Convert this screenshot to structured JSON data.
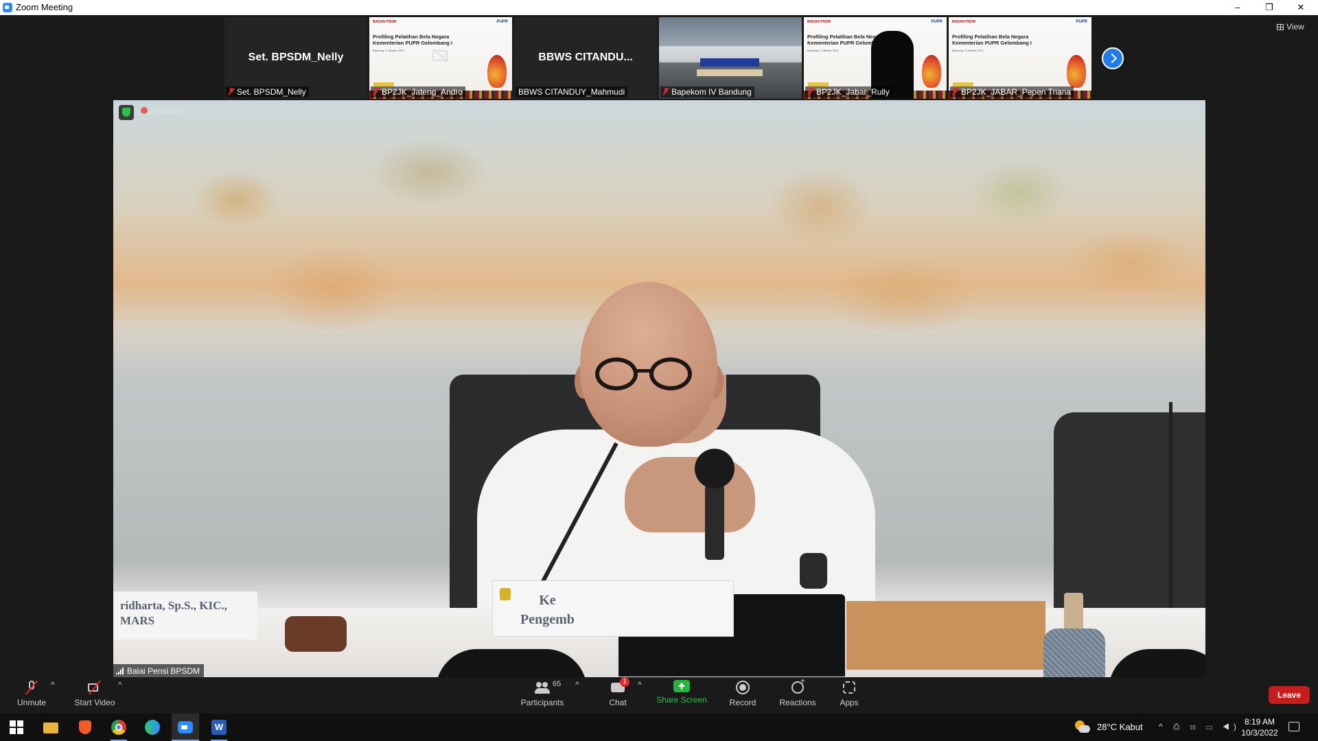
{
  "window": {
    "title": "Zoom Meeting",
    "min": "–",
    "max": "❐",
    "close": "✕"
  },
  "view_button": "View",
  "gallery": [
    {
      "big_name": "Set. BPSDM_Nelly",
      "label": "Set. BPSDM_Nelly",
      "muted": true,
      "kind": "name"
    },
    {
      "big_name": "",
      "label": "BP2JK_Jateng_Andro",
      "muted": true,
      "kind": "slide-camoff"
    },
    {
      "big_name": "BBWS  CITANDU...",
      "label": "BBWS CITANDUY_Mahmudi",
      "muted": false,
      "kind": "name"
    },
    {
      "big_name": "",
      "label": "Bapekom IV Bandung",
      "muted": true,
      "kind": "photo"
    },
    {
      "big_name": "",
      "label": "BP2JK_Jabar_Rully",
      "muted": true,
      "kind": "slide-person"
    },
    {
      "big_name": "",
      "label": "BP2JK_JABAR_Pepen Triana",
      "muted": true,
      "kind": "slide"
    }
  ],
  "slide": {
    "title": "Profiling Pelatihan Bela Negara Kementerian PUPR Gelombang I",
    "date": "Bandung, 3 Oktober 2022",
    "logo": "BADAN PSDM",
    "pupr": "PUPR"
  },
  "main_video": {
    "speaker_label": "Balai Pensi BPSDM",
    "recording": "Recording",
    "placard_left": "ridharta, Sp.S., KIC.,\nMARS",
    "placard_center": "Ke\nPengemb"
  },
  "controls": {
    "unmute": "Unmute",
    "start_video": "Start Video",
    "participants": "Participants",
    "participants_count": "65",
    "chat": "Chat",
    "chat_badge": "1",
    "share_screen": "Share Screen",
    "record": "Record",
    "reactions": "Reactions",
    "apps": "Apps",
    "leave": "Leave"
  },
  "taskbar": {
    "weather": "28°C  Kabut",
    "tray": "^ ⎙ ⊡ ▭ ◀)",
    "time": "8:19 AM",
    "date": "10/3/2022"
  },
  "colors": {
    "accent": "#2d8cff",
    "leave": "#c61d1d",
    "share": "#2ec24a",
    "muted": "#e02828"
  }
}
